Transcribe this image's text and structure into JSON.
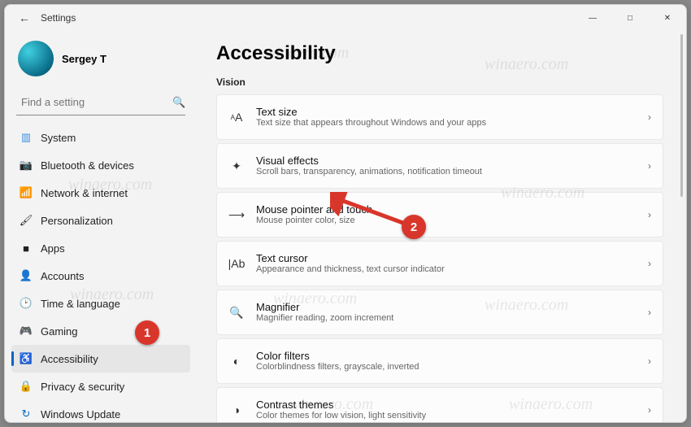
{
  "window": {
    "title": "Settings"
  },
  "user": {
    "name": "Sergey T"
  },
  "search": {
    "placeholder": "Find a setting"
  },
  "sidebar": {
    "items": [
      {
        "label": "System"
      },
      {
        "label": "Bluetooth & devices"
      },
      {
        "label": "Network & internet"
      },
      {
        "label": "Personalization"
      },
      {
        "label": "Apps"
      },
      {
        "label": "Accounts"
      },
      {
        "label": "Time & language"
      },
      {
        "label": "Gaming"
      },
      {
        "label": "Accessibility"
      },
      {
        "label": "Privacy & security"
      },
      {
        "label": "Windows Update"
      }
    ],
    "activeIndex": 8
  },
  "page": {
    "title": "Accessibility",
    "section": "Vision",
    "items": [
      {
        "title": "Text size",
        "desc": "Text size that appears throughout Windows and your apps"
      },
      {
        "title": "Visual effects",
        "desc": "Scroll bars, transparency, animations, notification timeout"
      },
      {
        "title": "Mouse pointer and touch",
        "desc": "Mouse pointer color, size"
      },
      {
        "title": "Text cursor",
        "desc": "Appearance and thickness, text cursor indicator"
      },
      {
        "title": "Magnifier",
        "desc": "Magnifier reading, zoom increment"
      },
      {
        "title": "Color filters",
        "desc": "Colorblindness filters, grayscale, inverted"
      },
      {
        "title": "Contrast themes",
        "desc": "Color themes for low vision, light sensitivity"
      }
    ]
  },
  "annotations": {
    "badge1": "1",
    "badge2": "2"
  },
  "watermark": "winaero.com"
}
